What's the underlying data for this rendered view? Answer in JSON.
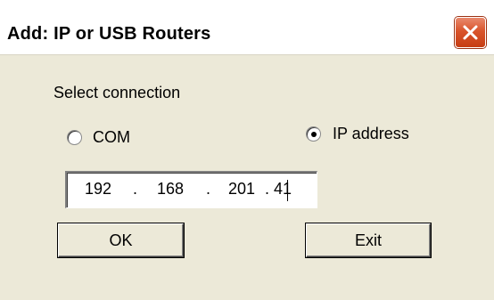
{
  "window": {
    "title": "Add: IP or USB Routers",
    "close_icon": "close-icon"
  },
  "connection": {
    "group_label": "Select connection",
    "options": [
      {
        "label": "COM",
        "selected": false
      },
      {
        "label": "IP address",
        "selected": true
      }
    ]
  },
  "ip_field": {
    "octets": [
      "192",
      "168",
      "201",
      "41"
    ],
    "separator": "."
  },
  "buttons": {
    "ok_label": "OK",
    "exit_label": "Exit"
  },
  "colors": {
    "dialog_background": "#ECE9D8",
    "close_button": "#D9542B"
  }
}
